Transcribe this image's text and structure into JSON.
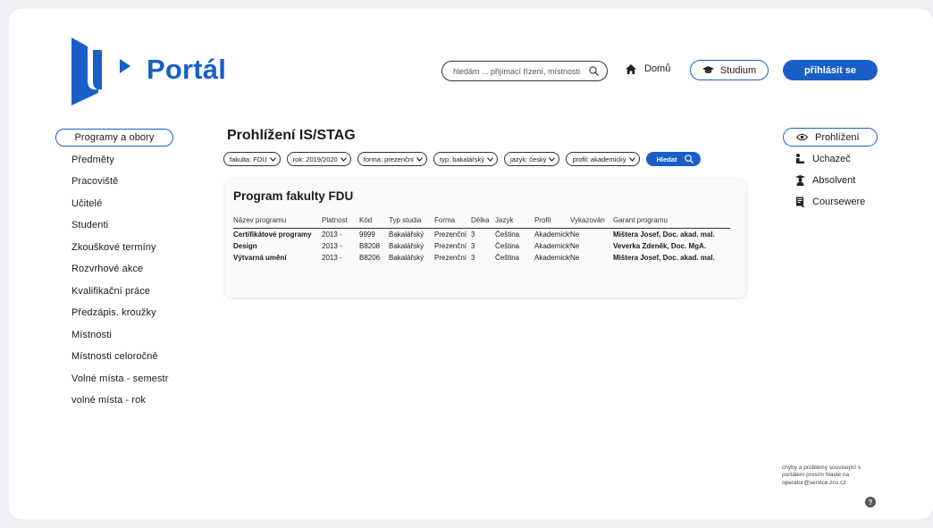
{
  "header": {
    "logo_text": "Portál",
    "search": {
      "placeholder": "hledám ... přijímací řízení, místnosti"
    },
    "home_label": "Domů",
    "study_label": "Studium",
    "login_label": "přihlásit se"
  },
  "sidebar": {
    "items": [
      {
        "label": "Programy a obory",
        "active": true
      },
      {
        "label": "Předměty"
      },
      {
        "label": "Pracoviště"
      },
      {
        "label": "Učitelé"
      },
      {
        "label": "Studenti"
      },
      {
        "label": "Zkouškové termíny"
      },
      {
        "label": "Rozvrhové akce"
      },
      {
        "label": "Kvalifikační práce"
      },
      {
        "label": "Předzápis. kroužky"
      },
      {
        "label": "Místnosti"
      },
      {
        "label": "Místnosti celoročně"
      },
      {
        "label": "Volné místa - semestr"
      },
      {
        "label": "volné místa - rok"
      }
    ]
  },
  "main": {
    "title": "Prohlížení IS/STAG",
    "filters": [
      "fakulta: FDU",
      "rok: 2019/2020",
      "forma: prezenční",
      "typ: bakalářský",
      "jazyk: český",
      "profil: akademický"
    ],
    "search_button": "Hledat",
    "card": {
      "title": "Program fakulty FDU",
      "columns": [
        "Název programu",
        "Platnost",
        "Kód",
        "Typ studia",
        "Forma",
        "Délka",
        "Jazyk",
        "Profil",
        "Vykazován",
        "Garant programu"
      ],
      "rows": [
        [
          "Certifikátové programy",
          "2013 -",
          "9999",
          "Bakalářský",
          "Prezenční",
          "3",
          "Čeština",
          "Akademický",
          "Ne",
          "Mištera Josef, Doc. akad. mal."
        ],
        [
          "Design",
          "2013 -",
          "B8208",
          "Bakalářský",
          "Prezenční",
          "3",
          "Čeština",
          "Akademický",
          "Ne",
          "Veverka Zdeněk, Doc. MgA."
        ],
        [
          "Výtvarná umění",
          "2013 -",
          "B8206",
          "Bakalářský",
          "Prezenční",
          "3",
          "Čeština",
          "Akademický",
          "Ne",
          "Mištera Josef, Doc. akad. mal."
        ]
      ]
    }
  },
  "right_panel": {
    "items": [
      {
        "label": "Prohlížení",
        "icon": "eye-icon",
        "active": true
      },
      {
        "label": "Uchazeč",
        "icon": "person-seated-icon"
      },
      {
        "label": "Absolvent",
        "icon": "graduate-icon"
      },
      {
        "label": "Coursewere",
        "icon": "document-icon"
      }
    ]
  },
  "footer": {
    "note": "chyby a problémy související s portálem prosím hlaste na operator@service.zcu.cz",
    "help_icon": "?"
  },
  "colors": {
    "accent": "#1a5fc8"
  }
}
